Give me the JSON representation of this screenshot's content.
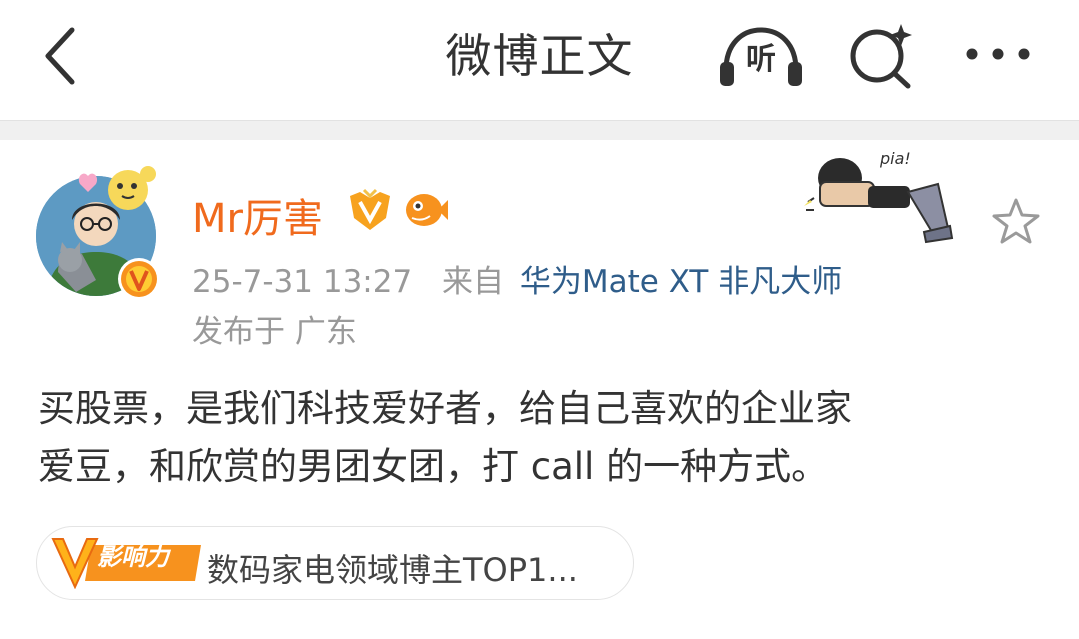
{
  "nav": {
    "title": "微博正文",
    "listen_label": "听"
  },
  "post": {
    "author": {
      "name": "Mr厉害"
    },
    "time": "25-7-31 13:27",
    "source_prefix": "来自",
    "source": "华为Mate XT 非凡大师",
    "location": "发布于 广东",
    "sticker_text": "pia!",
    "content": [
      "买股票，是我们科技爱好者，给自己喜欢的企业家",
      "爱豆，和欣赏的男团女团，打 call 的一种方式。"
    ],
    "influence_tag": {
      "badge_label": "影响力",
      "text": "数码家电领域博主TOP1..."
    }
  },
  "colors": {
    "username": "#f06a1d",
    "source_link": "#2f5d8a",
    "meta": "#999999",
    "text": "#333333",
    "badge_orange": "#f7921e"
  },
  "icons": {
    "back": "chevron-left-icon",
    "listen": "headphones-icon",
    "search": "ai-search-icon",
    "more": "more-dots-icon",
    "favorite": "star-outline-icon"
  }
}
